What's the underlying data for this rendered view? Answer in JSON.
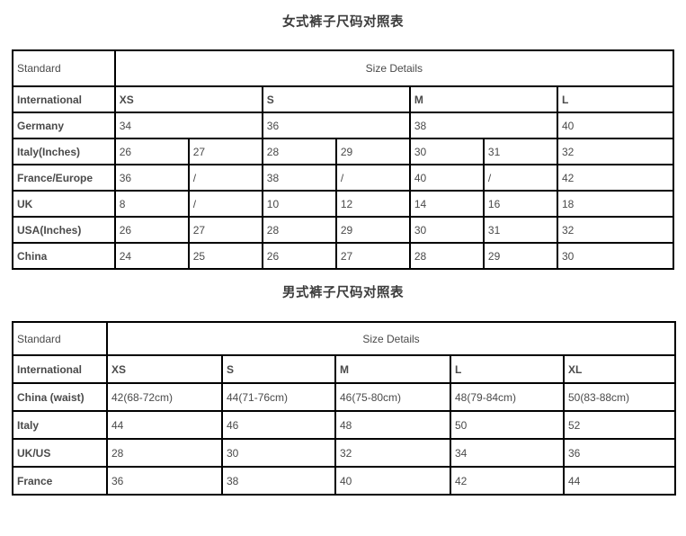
{
  "women": {
    "title": "女式裤子尺码对照表",
    "standard_label": "Standard",
    "size_details_label": "Size Details",
    "column_count": 7,
    "rows": [
      {
        "label": "International",
        "bold_values": true,
        "cells": [
          {
            "text": "XS",
            "span": 2
          },
          {
            "text": "S",
            "span": 2
          },
          {
            "text": "M",
            "span": 2
          },
          {
            "text": "L",
            "span": 1
          }
        ]
      },
      {
        "label": "Germany",
        "bold_values": false,
        "cells": [
          {
            "text": "34",
            "span": 2
          },
          {
            "text": "36",
            "span": 2
          },
          {
            "text": "38",
            "span": 2
          },
          {
            "text": "40",
            "span": 1
          }
        ]
      },
      {
        "label": "Italy(Inches)",
        "bold_values": false,
        "cells": [
          {
            "text": "26",
            "span": 1
          },
          {
            "text": "27",
            "span": 1
          },
          {
            "text": "28",
            "span": 1
          },
          {
            "text": "29",
            "span": 1
          },
          {
            "text": "30",
            "span": 1
          },
          {
            "text": "31",
            "span": 1
          },
          {
            "text": "32",
            "span": 1
          }
        ]
      },
      {
        "label": "France/Europe",
        "bold_values": false,
        "cells": [
          {
            "text": "36",
            "span": 1
          },
          {
            "text": "/",
            "span": 1
          },
          {
            "text": "38",
            "span": 1
          },
          {
            "text": "/",
            "span": 1
          },
          {
            "text": "40",
            "span": 1
          },
          {
            "text": "/",
            "span": 1
          },
          {
            "text": "42",
            "span": 1
          }
        ]
      },
      {
        "label": "UK",
        "bold_values": false,
        "cells": [
          {
            "text": "8",
            "span": 1
          },
          {
            "text": "/",
            "span": 1
          },
          {
            "text": "10",
            "span": 1
          },
          {
            "text": "12",
            "span": 1
          },
          {
            "text": "14",
            "span": 1
          },
          {
            "text": "16",
            "span": 1
          },
          {
            "text": "18",
            "span": 1
          }
        ]
      },
      {
        "label": "USA(Inches)",
        "bold_values": false,
        "cells": [
          {
            "text": "26",
            "span": 1
          },
          {
            "text": "27",
            "span": 1
          },
          {
            "text": "28",
            "span": 1
          },
          {
            "text": "29",
            "span": 1
          },
          {
            "text": "30",
            "span": 1
          },
          {
            "text": "31",
            "span": 1
          },
          {
            "text": "32",
            "span": 1
          }
        ]
      },
      {
        "label": "China",
        "bold_values": false,
        "cells": [
          {
            "text": "24",
            "span": 1
          },
          {
            "text": "25",
            "span": 1
          },
          {
            "text": "26",
            "span": 1
          },
          {
            "text": "27",
            "span": 1
          },
          {
            "text": "28",
            "span": 1
          },
          {
            "text": "29",
            "span": 1
          },
          {
            "text": "30",
            "span": 1
          }
        ]
      }
    ]
  },
  "men": {
    "title": "男式裤子尺码对照表",
    "standard_label": "Standard",
    "size_details_label": "Size Details",
    "column_count": 5,
    "rows": [
      {
        "label": "International",
        "bold_values": true,
        "cells": [
          {
            "text": "XS",
            "span": 1
          },
          {
            "text": "S",
            "span": 1
          },
          {
            "text": "M",
            "span": 1
          },
          {
            "text": "L",
            "span": 1
          },
          {
            "text": "XL",
            "span": 1
          }
        ]
      },
      {
        "label": "China (waist)",
        "bold_values": false,
        "cells": [
          {
            "text": "42(68-72cm)",
            "span": 1
          },
          {
            "text": "44(71-76cm)",
            "span": 1
          },
          {
            "text": "46(75-80cm)",
            "span": 1
          },
          {
            "text": "48(79-84cm)",
            "span": 1
          },
          {
            "text": "50(83-88cm)",
            "span": 1
          }
        ]
      },
      {
        "label": "Italy",
        "bold_values": false,
        "cells": [
          {
            "text": "44",
            "span": 1
          },
          {
            "text": "46",
            "span": 1
          },
          {
            "text": "48",
            "span": 1
          },
          {
            "text": "50",
            "span": 1
          },
          {
            "text": "52",
            "span": 1
          }
        ]
      },
      {
        "label": "UK/US",
        "bold_values": false,
        "cells": [
          {
            "text": "28",
            "span": 1
          },
          {
            "text": "30",
            "span": 1
          },
          {
            "text": "32",
            "span": 1
          },
          {
            "text": "34",
            "span": 1
          },
          {
            "text": "36",
            "span": 1
          }
        ]
      },
      {
        "label": "France",
        "bold_values": false,
        "cells": [
          {
            "text": "36",
            "span": 1
          },
          {
            "text": "38",
            "span": 1
          },
          {
            "text": "40",
            "span": 1
          },
          {
            "text": "42",
            "span": 1
          },
          {
            "text": "44",
            "span": 1
          }
        ]
      }
    ]
  },
  "colors": {
    "border": "#000000",
    "text": "#4a4a4a",
    "label_text": "#2e2e2e",
    "background": "#ffffff"
  }
}
